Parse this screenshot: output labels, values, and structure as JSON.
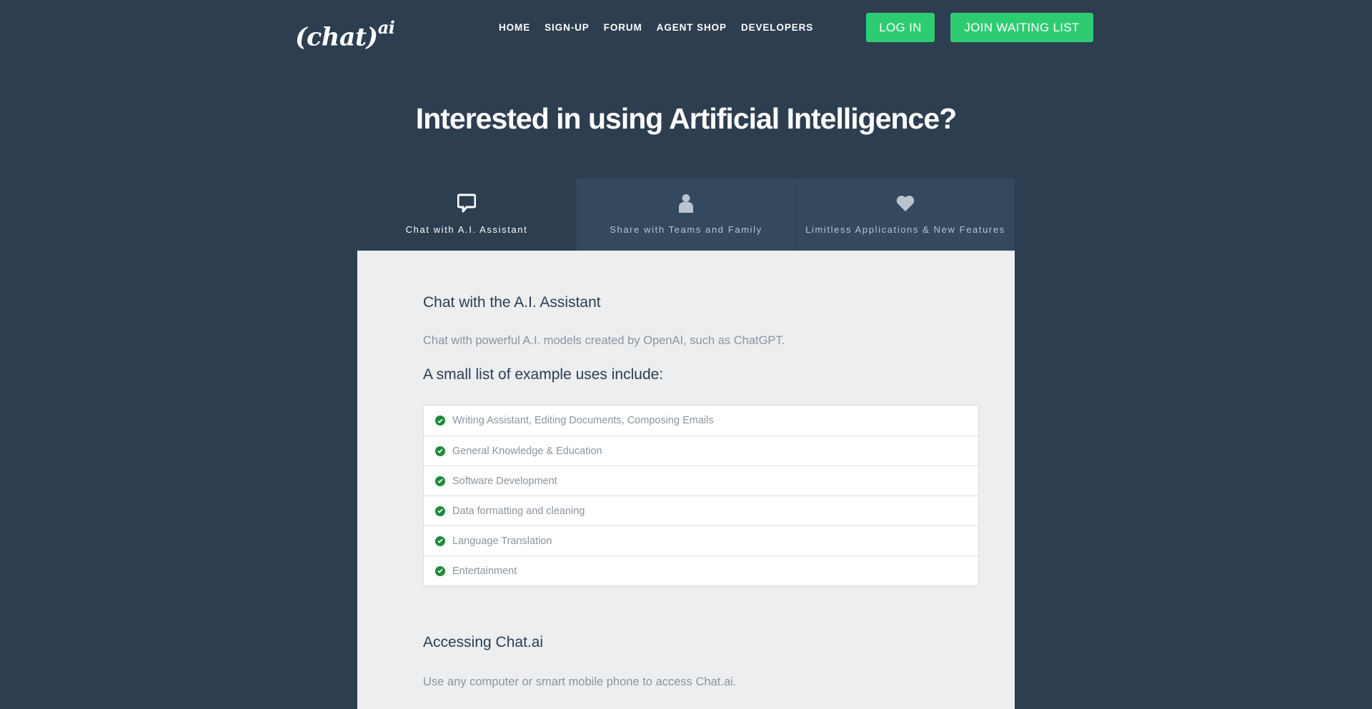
{
  "brand": {
    "name": "(chat)",
    "sup": "ai"
  },
  "nav": [
    "HOME",
    "SIGN-UP",
    "FORUM",
    "AGENT SHOP",
    "DEVELOPERS"
  ],
  "buttons": {
    "login": "LOG IN",
    "join": "JOIN WAITING LIST"
  },
  "hero": {
    "title": "Interested in using Artificial Intelligence?"
  },
  "tabs": [
    {
      "label": "Chat with A.I. Assistant",
      "icon": "chat-bubble-icon",
      "active": true
    },
    {
      "label": "Share with Teams and Family",
      "icon": "person-icon",
      "active": false
    },
    {
      "label": "Limitless Applications & New Features",
      "icon": "heart-icon",
      "active": false
    }
  ],
  "content": {
    "chat_heading": "Chat with the A.I. Assistant",
    "chat_text": "Chat with powerful A.I. models created by OpenAI, such as ChatGPT.",
    "list_heading": "A small list of example uses include:",
    "uses": [
      "Writing Assistant, Editing Documents, Composing Emails",
      "General Knowledge & Education",
      "Software Development",
      "Data formatting and cleaning",
      "Language Translation",
      "Entertainment"
    ],
    "access_heading": "Accessing Chat.ai",
    "access_text": "Use any computer or smart mobile phone to access Chat.ai."
  },
  "colors": {
    "background": "#2d3e50",
    "accent": "#2ecc71",
    "check": "#1e8a3a",
    "panel": "#eceef0"
  }
}
